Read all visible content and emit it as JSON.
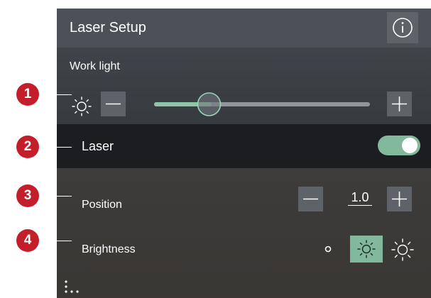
{
  "header": {
    "title": "Laser Setup",
    "info_icon": "info-icon"
  },
  "work_light": {
    "label": "Work light",
    "icon": "sun-icon",
    "slider_level": 0.25
  },
  "laser": {
    "label": "Laser",
    "enabled": true
  },
  "position": {
    "label": "Position",
    "value": "1.0"
  },
  "brightness": {
    "label": "Brightness",
    "options": [
      "low",
      "medium",
      "high"
    ],
    "selected": "medium"
  },
  "markers": [
    "1",
    "2",
    "3",
    "4"
  ],
  "colors": {
    "marker": "#c41e2a",
    "accent": "#82b89c",
    "header": "#4b5157"
  }
}
